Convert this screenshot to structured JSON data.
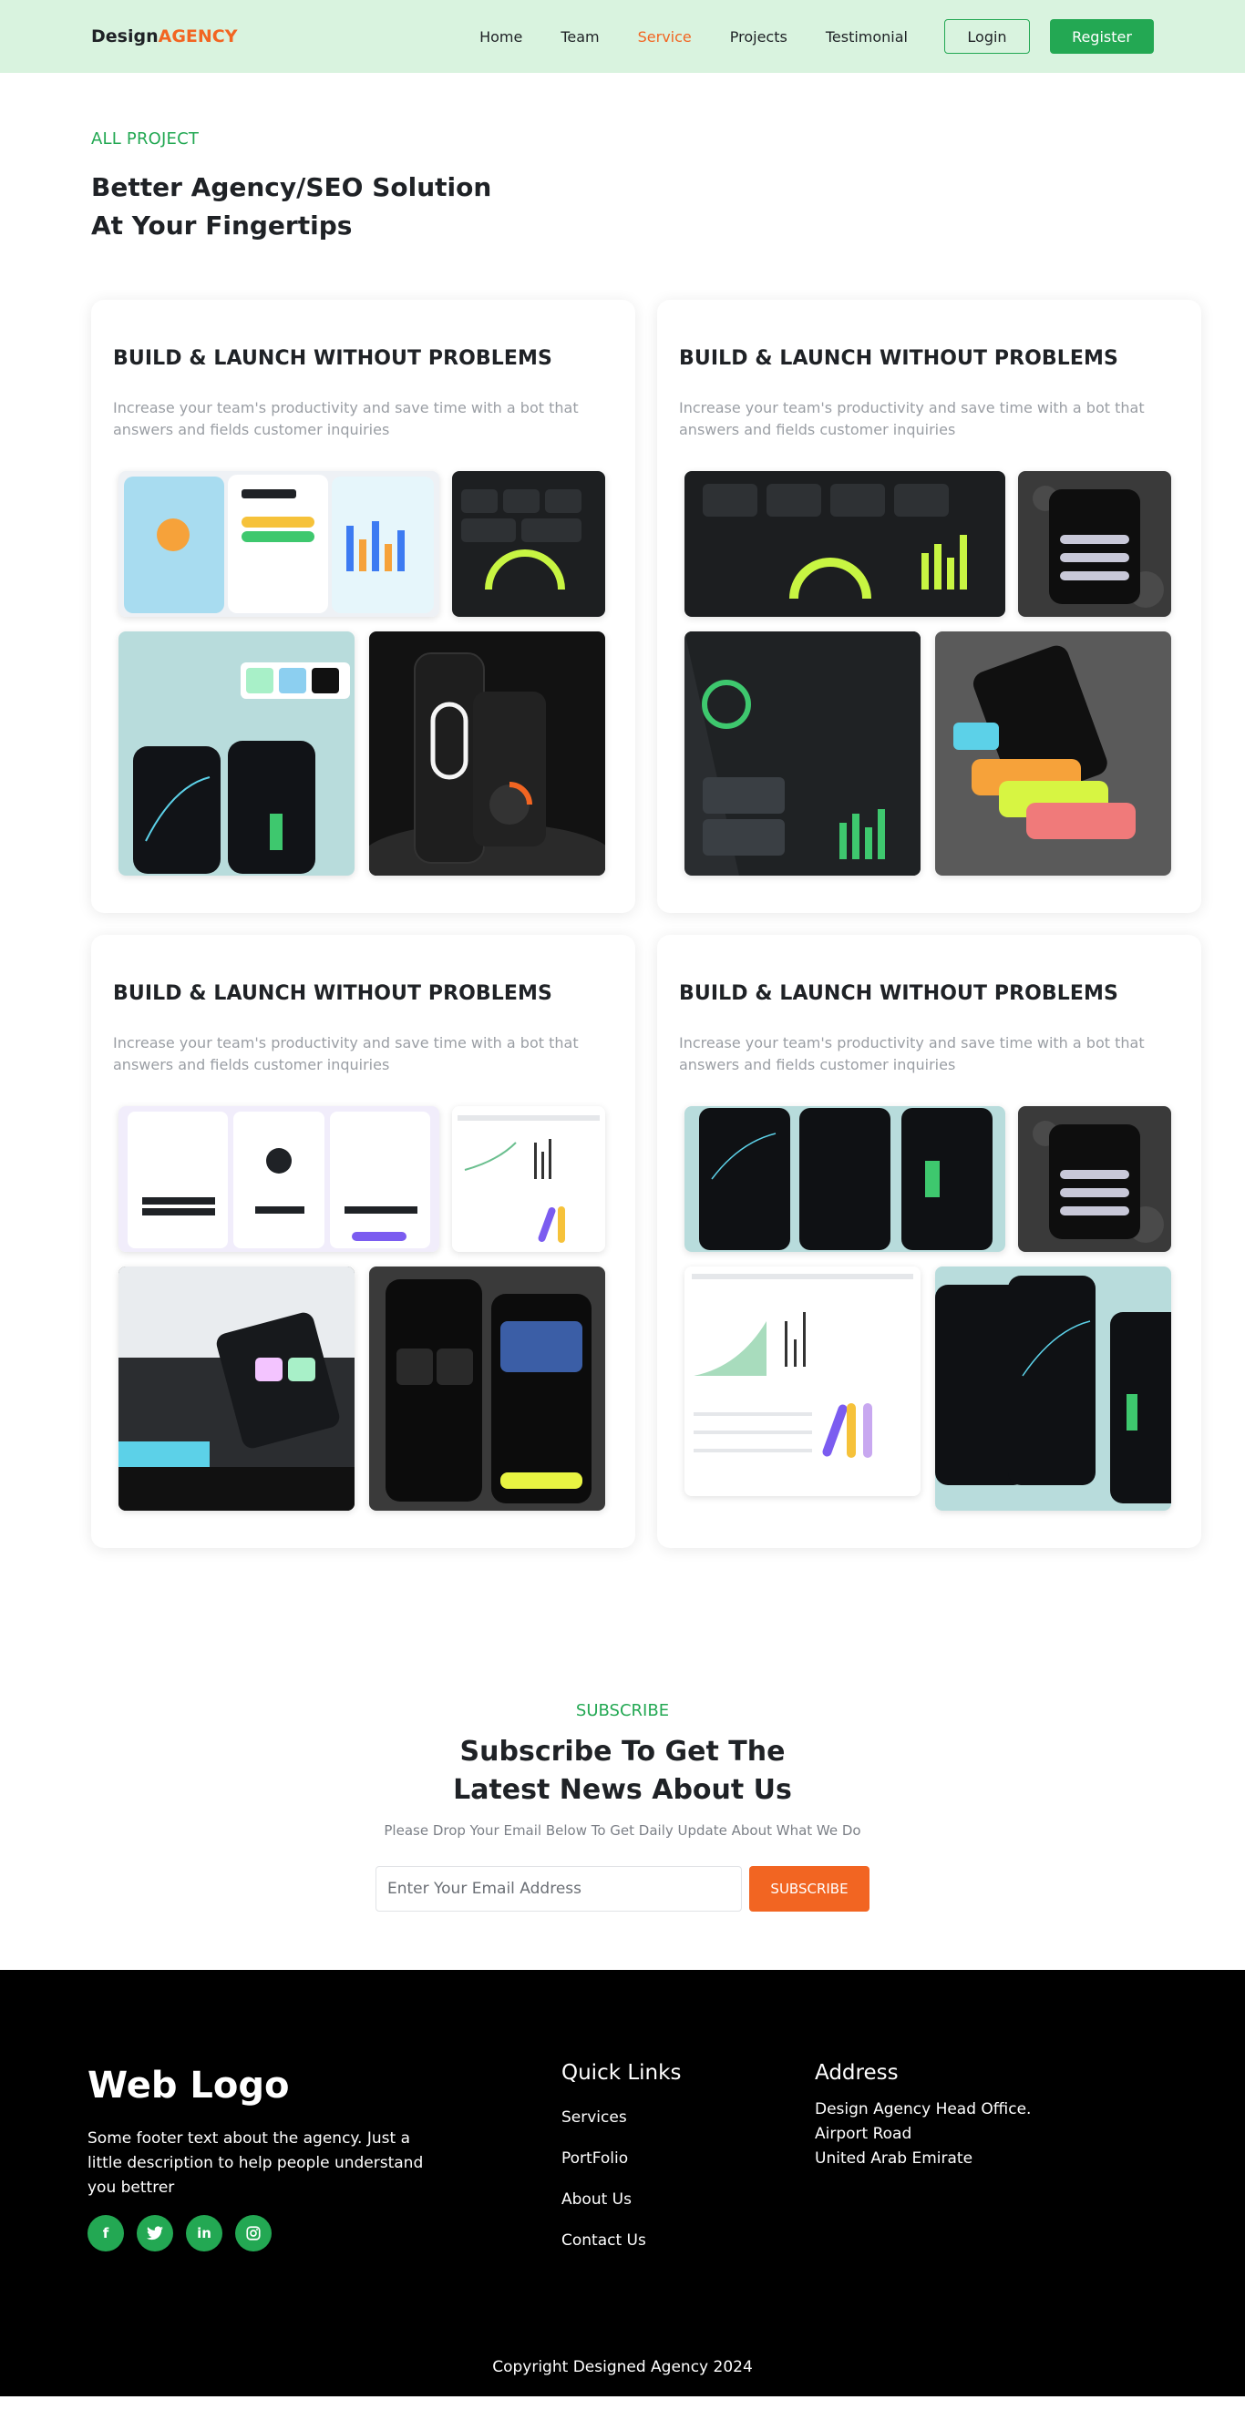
{
  "nav": {
    "logo_main": "Design",
    "logo_accent": "AGENCY",
    "links": [
      "Home",
      "Team",
      "Service",
      "Projects",
      "Testimonial"
    ],
    "login": "Login",
    "register": "Register"
  },
  "hero": {
    "eyebrow": "ALL PROJECT",
    "title": "Better Agency/SEO Solution At Your Fingertips"
  },
  "cards": [
    {
      "title": "BUILD & LAUNCH WITHOUT PROBLEMS",
      "text": "Increase your team's productivity and save time with a bot that answers and fields customer inquiries"
    },
    {
      "title": "BUILD & LAUNCH WITHOUT PROBLEMS",
      "text": "Increase your team's productivity and save time with a bot that answers and fields customer inquiries"
    },
    {
      "title": "BUILD & LAUNCH WITHOUT PROBLEMS",
      "text": "Increase your team's productivity and save time with a bot that answers and fields customer inquiries"
    },
    {
      "title": "BUILD & LAUNCH WITHOUT PROBLEMS",
      "text": "Increase your team's productivity and save time with a bot that answers and fields customer inquiries"
    }
  ],
  "subscribe": {
    "eyebrow": "SUBSCRIBE",
    "title": "Subscribe To Get The Latest News About Us",
    "text": "Please Drop Your Email Below To Get Daily Update About What We Do",
    "placeholder": "Enter Your Email Address",
    "button": "SUBSCRIBE"
  },
  "footer": {
    "logo": "Web Logo",
    "text": "Some footer text about the agency. Just a little description to help people understand you bettrer",
    "socials": [
      "facebook-icon",
      "twitter-icon",
      "linkedin-icon",
      "instagram-icon"
    ],
    "quick_links_title": "Quick Links",
    "quick_links": [
      "Services",
      "PortFolio",
      "About Us",
      "Contact Us"
    ],
    "address_title": "Address",
    "address_lines": [
      "Design Agency Head Office.",
      "Airport Road",
      "United Arab Emirate"
    ],
    "copyright": "Copyright Designed Agency 2024"
  },
  "colors": {
    "brand_green": "#23a853",
    "accent_orange": "#f26522",
    "nav_bg": "#d9f3df",
    "footer_bg": "#000000"
  }
}
